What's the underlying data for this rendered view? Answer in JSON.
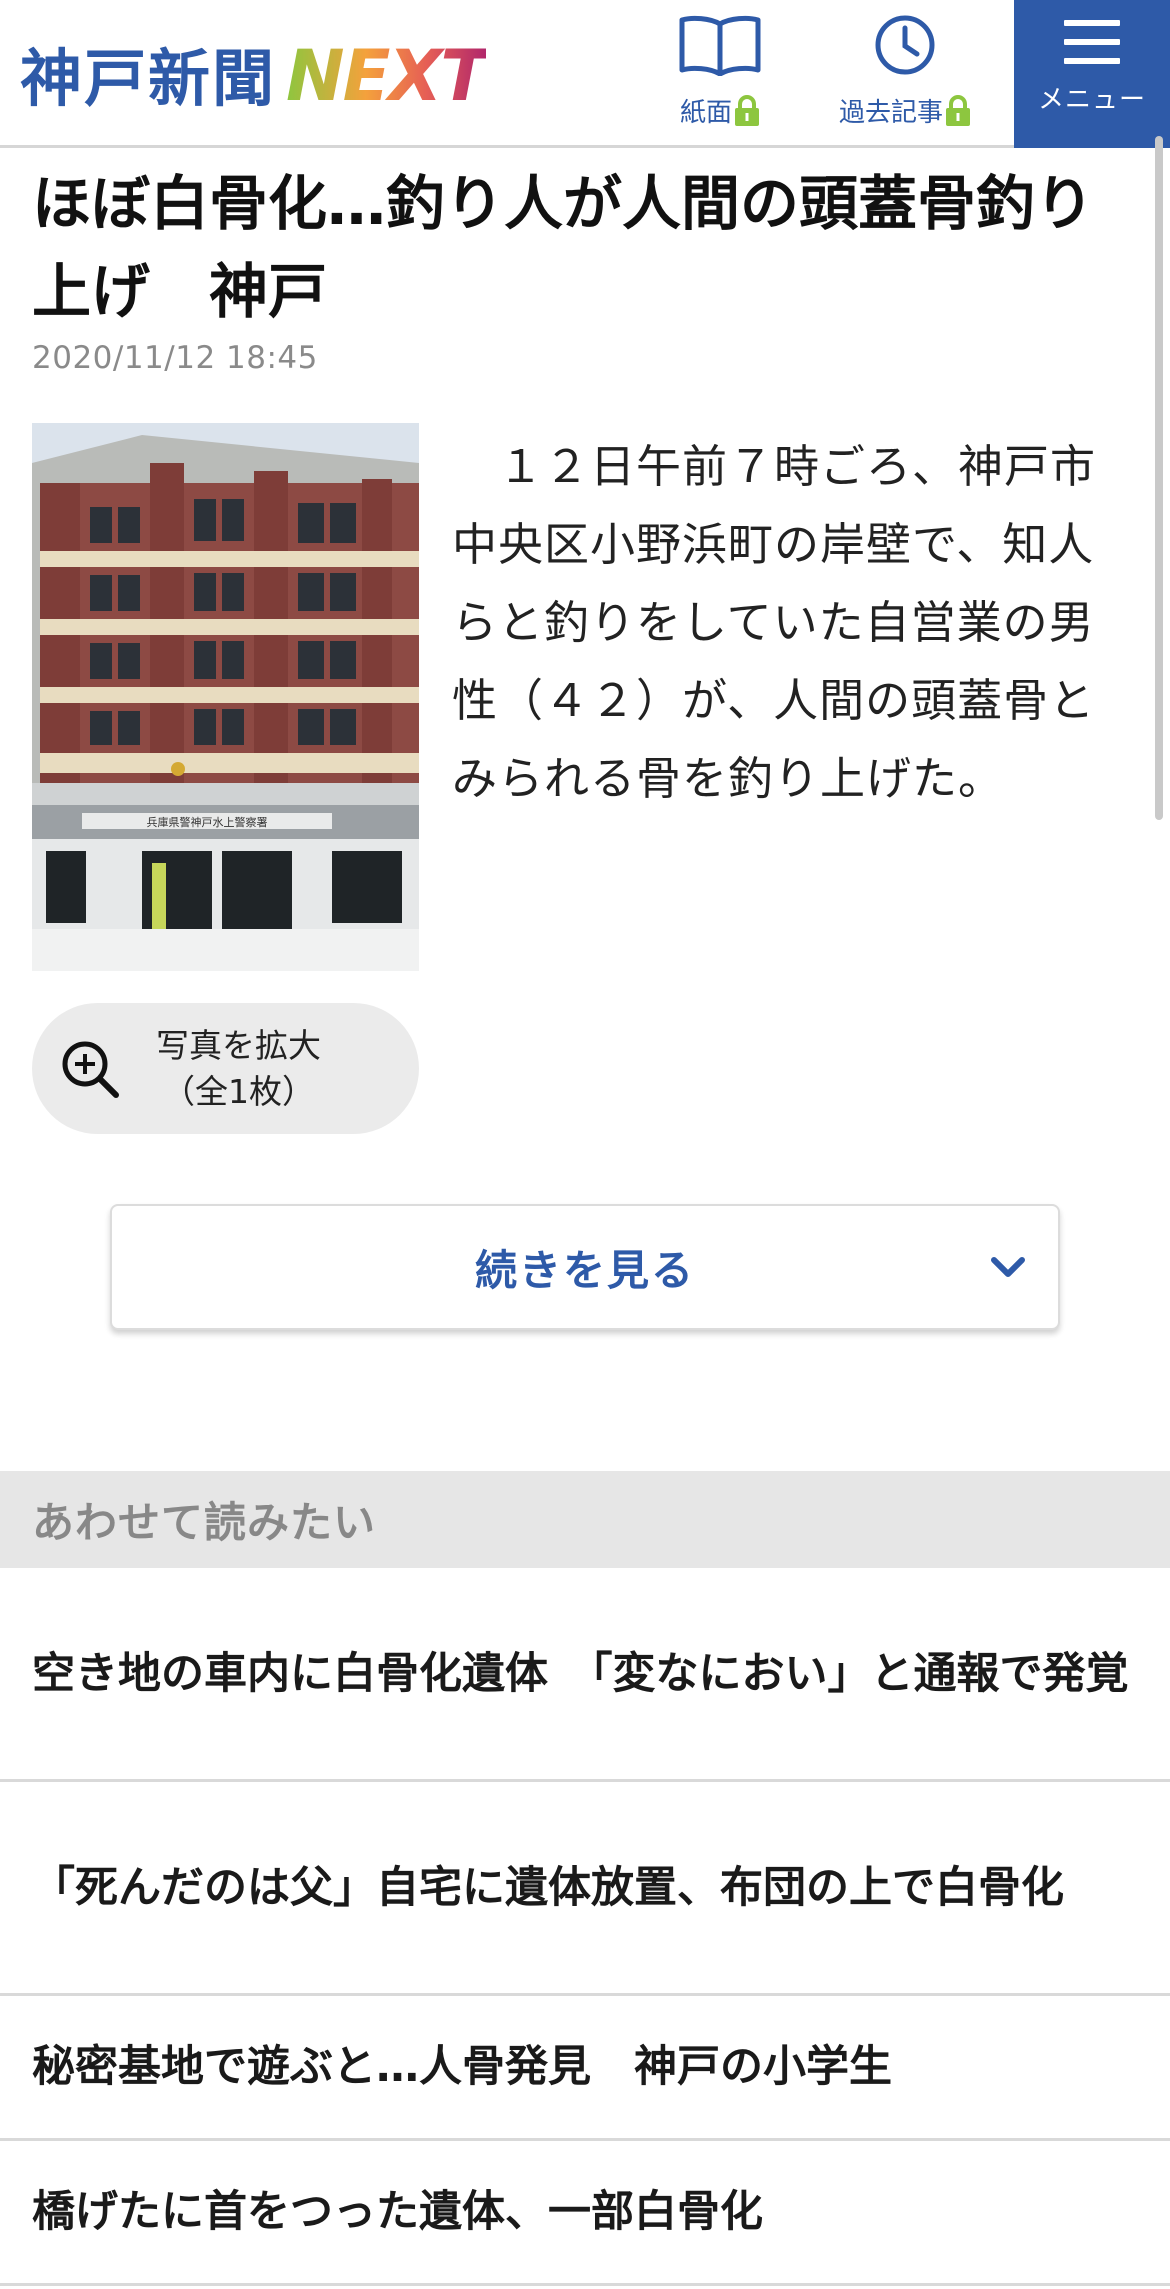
{
  "header": {
    "logo_jp": "神戸新聞",
    "logo_next": "NEXT",
    "nav": [
      {
        "label": "紙面",
        "icon": "book-icon",
        "locked": true
      },
      {
        "label": "過去記事",
        "icon": "clock-icon",
        "locked": true
      }
    ],
    "menu_label": "メニュー"
  },
  "article": {
    "title": "ほぼ白骨化…釣り人が人間の頭蓋骨釣り上げ　神戸",
    "date": "2020/11/12 18:45",
    "lead": "　１２日午前７時ごろ、神戸市中央区小野浜町の岸壁で、知人らと釣りをしていた自営業の男性（４２）が、人間の頭蓋骨とみられる骨を釣り上げた。",
    "photo": {
      "sign_text": "兵庫県警神戸水上警察署"
    },
    "zoom_button": {
      "line1": "写真を拡大",
      "line2": "（全1枚）"
    },
    "more_button": "続きを見る"
  },
  "related": {
    "heading": "あわせて読みたい",
    "items": [
      {
        "title": "空き地の車内に白骨化遺体　「変なにおい」と通報で発覚"
      },
      {
        "title": "「死んだのは父」自宅に遺体放置、布団の上で白骨化"
      },
      {
        "title": "秘密基地で遊ぶと…人骨発見　神戸の小学生"
      },
      {
        "title": "橋げたに首をつった遺体、一部白骨化"
      }
    ]
  },
  "colors": {
    "brand_blue": "#2e5aa8",
    "date_gray": "#8a8a8a",
    "lock_green": "#8dc63f"
  }
}
